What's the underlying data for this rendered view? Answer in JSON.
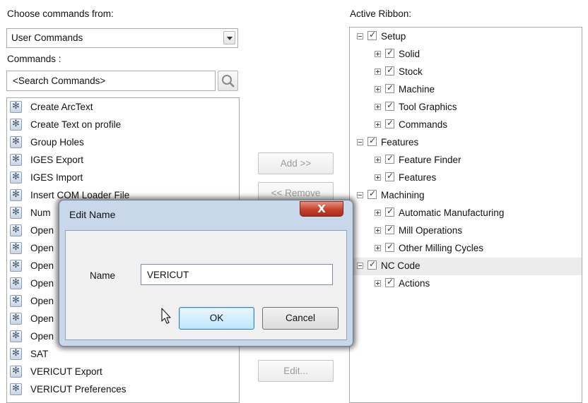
{
  "left_panel": {
    "choose_label": "Choose commands from:",
    "source_combo_value": "User Commands",
    "commands_label": "Commands :",
    "search_placeholder": "<Search Commands>",
    "commands": [
      "Create ArcText",
      "Create Text on profile",
      "Group Holes",
      "IGES Export",
      "IGES Import",
      "Insert COM Loader File",
      "Num",
      "Open",
      "Open",
      "Open",
      "Open",
      "Open",
      "Open",
      "Open",
      "SAT",
      "VERICUT Export",
      "VERICUT Preferences"
    ]
  },
  "middle_buttons": {
    "add": "Add >>",
    "remove": "<< Remove",
    "edit": "Edit..."
  },
  "right_panel": {
    "label": "Active Ribbon:",
    "tree": [
      {
        "level": 0,
        "label": "Setup",
        "expanded": true
      },
      {
        "level": 1,
        "label": "Solid",
        "expanded": false
      },
      {
        "level": 1,
        "label": "Stock",
        "expanded": false
      },
      {
        "level": 1,
        "label": "Machine",
        "expanded": false
      },
      {
        "level": 1,
        "label": "Tool Graphics",
        "expanded": false
      },
      {
        "level": 1,
        "label": "Commands",
        "expanded": false
      },
      {
        "level": 0,
        "label": "Features",
        "expanded": true
      },
      {
        "level": 1,
        "label": "Feature Finder",
        "expanded": false
      },
      {
        "level": 1,
        "label": "Features",
        "expanded": false
      },
      {
        "level": 0,
        "label": "Machining",
        "expanded": true
      },
      {
        "level": 1,
        "label": "Automatic Manufacturing",
        "expanded": false
      },
      {
        "level": 1,
        "label": "Mill Operations",
        "expanded": false
      },
      {
        "level": 1,
        "label": "Other Milling Cycles",
        "expanded": false
      },
      {
        "level": 0,
        "label": "NC Code",
        "expanded": true,
        "selected": true
      },
      {
        "level": 1,
        "label": "Actions",
        "expanded": false
      }
    ]
  },
  "dialog": {
    "title": "Edit Name",
    "close_glyph": "X",
    "name_label": "Name",
    "name_value": "VERICUT",
    "ok": "OK",
    "cancel": "Cancel"
  },
  "icons": {
    "command_icon": "gear-icon",
    "search_icon": "magnifier-icon",
    "combo_arrow": "chevron-down-icon",
    "cursor": "mouse-pointer-icon"
  }
}
